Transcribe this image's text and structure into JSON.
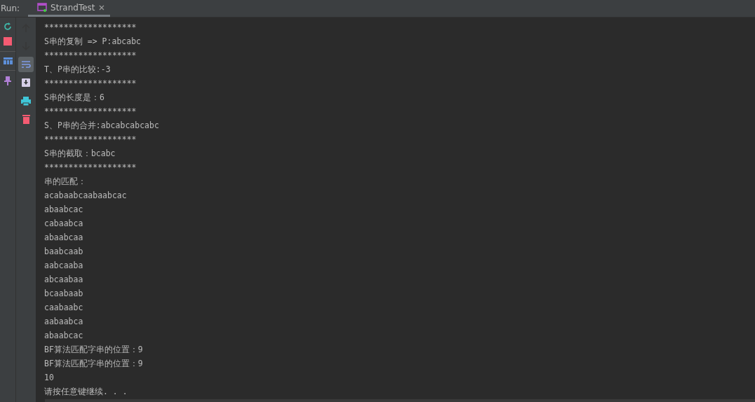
{
  "run_label": "Run:",
  "tab": {
    "title": "StrandTest",
    "selected": true
  },
  "side_tools": [
    {
      "kind": "rerun"
    },
    {
      "kind": "stop"
    },
    {
      "kind": "layout"
    },
    {
      "kind": "pin"
    }
  ],
  "console_tools": [
    {
      "kind": "up",
      "disabled": true,
      "selected": false
    },
    {
      "kind": "down",
      "disabled": true,
      "selected": false
    },
    {
      "kind": "wrap",
      "disabled": false,
      "selected": true
    },
    {
      "kind": "scroll-end",
      "disabled": false,
      "selected": false
    },
    {
      "kind": "print",
      "disabled": false,
      "selected": false
    },
    {
      "kind": "trash",
      "disabled": false,
      "selected": false
    }
  ],
  "lines": [
    "*******************",
    "S串的复制 => P:abcabc",
    "*******************",
    "T、P串的比较:-3",
    "*******************",
    "S串的长度是：6",
    "*******************",
    "S、P串的合并:abcabcabcabc",
    "*******************",
    "S串的截取：bcabc",
    "*******************",
    "串的匹配：",
    "acabaabcaabaabcac",
    "abaabcac",
    "cabaabca",
    "abaabcaa",
    "baabcaab",
    "aabcaaba",
    "abcaabaa",
    "bcaabaab",
    "caabaabc",
    "aabaabca",
    "abaabcac",
    "BF算法匹配字串的位置：9",
    "BF算法匹配字串的位置：9",
    "10",
    "请按任意键继续. . ."
  ]
}
